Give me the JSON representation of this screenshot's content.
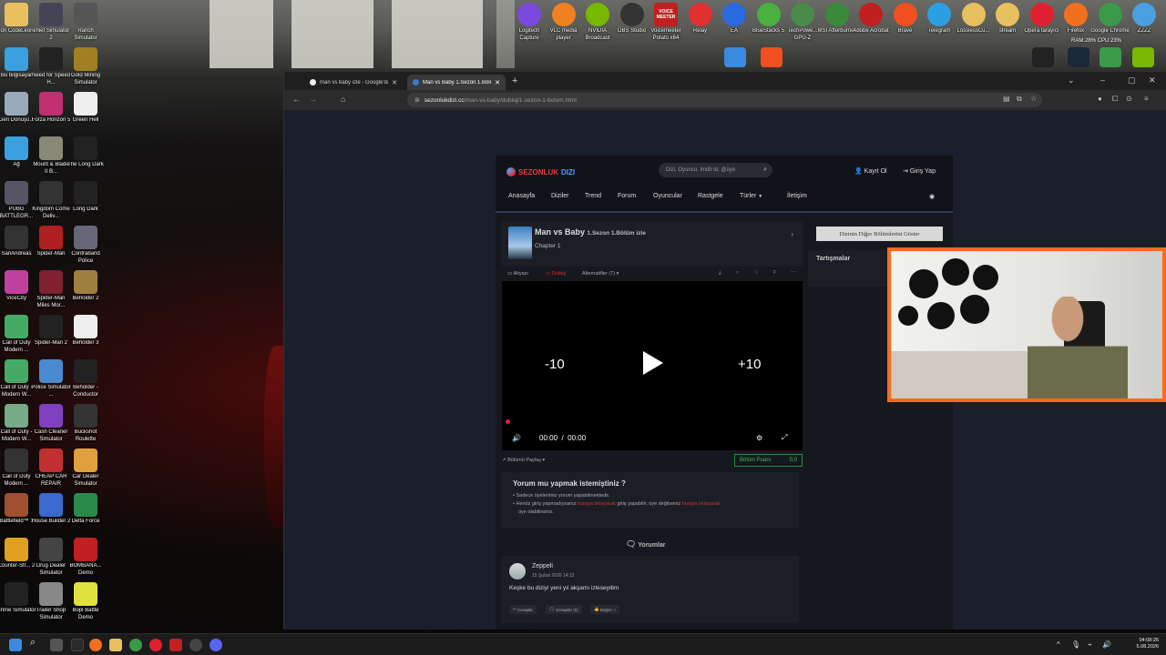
{
  "desktop": {
    "left_icons": [
      {
        "label": "Don CodeLeone",
        "icon": "folder-icon",
        "color": "#e8c060"
      },
      {
        "label": "Thief Simulator 2",
        "icon": "game-icon",
        "color": "#445"
      },
      {
        "label": "Ranch Simulator",
        "icon": "game-icon",
        "color": "#555"
      },
      {
        "label": "Bu bilgisayar",
        "icon": "computer-icon",
        "color": "#3aa0e0"
      },
      {
        "label": "Need for Speed H...",
        "icon": "game-icon",
        "color": "#222"
      },
      {
        "label": "Gold Mining Simulator",
        "icon": "game-icon",
        "color": "#a08020"
      },
      {
        "label": "Geri Dönüşü...",
        "icon": "recycle-bin-icon",
        "color": "#9ab"
      },
      {
        "label": "Forza Horizon 5",
        "icon": "game-icon",
        "color": "#c03070"
      },
      {
        "label": "Green Hell",
        "icon": "game-icon",
        "color": "#eee"
      },
      {
        "label": "Ağ",
        "icon": "network-icon",
        "color": "#3aa0e0"
      },
      {
        "label": "Mount & Blade II B...",
        "icon": "game-icon",
        "color": "#887"
      },
      {
        "label": "The Long Dark",
        "icon": "game-icon",
        "color": "#222"
      },
      {
        "label": "PUBG BATTLEGR...",
        "icon": "game-icon",
        "color": "#556"
      },
      {
        "label": "Kingdom Come Deliv...",
        "icon": "game-icon",
        "color": "#333"
      },
      {
        "label": "Long Dark",
        "icon": "game-icon",
        "color": "#222"
      },
      {
        "label": "SanAndreas",
        "icon": "game-icon",
        "color": "#333"
      },
      {
        "label": "Spider-Man",
        "icon": "game-icon",
        "color": "#b02020"
      },
      {
        "label": "Contraband Police",
        "icon": "game-icon",
        "color": "#667"
      },
      {
        "label": "ViceCity",
        "icon": "game-icon",
        "color": "#c040a0"
      },
      {
        "label": "Spider-Man Miles Mor...",
        "icon": "game-icon",
        "color": "#802030"
      },
      {
        "label": "Beholder 2",
        "icon": "game-icon",
        "color": "#a08040"
      },
      {
        "label": "Call of Duty Modern ...",
        "icon": "game-icon",
        "color": "#4a6"
      },
      {
        "label": "Spider-Man 2",
        "icon": "game-icon",
        "color": "#222"
      },
      {
        "label": "Beholder 3",
        "icon": "game-icon",
        "color": "#eee"
      },
      {
        "label": "Call of Duty - Modern W...",
        "icon": "game-icon",
        "color": "#4a6"
      },
      {
        "label": "Police Simulator ...",
        "icon": "game-icon",
        "color": "#4a8ad0"
      },
      {
        "label": "Beholder - Conductor",
        "icon": "game-icon",
        "color": "#222"
      },
      {
        "label": "Call of Duty - Modern W...",
        "icon": "game-icon",
        "color": "#7a8"
      },
      {
        "label": "Cash Cleaner Simulator",
        "icon": "game-icon",
        "color": "#8040c0"
      },
      {
        "label": "Buckshot Roulette",
        "icon": "game-icon",
        "color": "#333"
      },
      {
        "label": "Call of Duty Modern ...",
        "icon": "game-icon",
        "color": "#333"
      },
      {
        "label": "CHEAP CAR REPAIR",
        "icon": "game-icon",
        "color": "#c03030"
      },
      {
        "label": "Car Dealer Simulator",
        "icon": "game-icon",
        "color": "#e0a040"
      },
      {
        "label": "Battlefield™ 1",
        "icon": "game-icon",
        "color": "#a05030"
      },
      {
        "label": "House Builder 2",
        "icon": "game-icon",
        "color": "#3a6ad0"
      },
      {
        "label": "Delta Force",
        "icon": "game-icon",
        "color": "#2a8a4a"
      },
      {
        "label": "Counter-Str... 2",
        "icon": "game-icon",
        "color": "#e0a020"
      },
      {
        "label": "Drug Dealer Simulator",
        "icon": "game-icon",
        "color": "#444"
      },
      {
        "label": "BOMBANA... Demo",
        "icon": "game-icon",
        "color": "#c02020"
      },
      {
        "label": "Crime Simulator",
        "icon": "game-icon",
        "color": "#222"
      },
      {
        "label": "Trailer Shop Simulator",
        "icon": "game-icon",
        "color": "#888"
      },
      {
        "label": "Bopl Battle Demo",
        "icon": "game-icon",
        "color": "#e0e040"
      }
    ],
    "top_icons": [
      {
        "label": "Logitech Capture",
        "color": "#7a4ae0"
      },
      {
        "label": "VLC media player",
        "color": "#f08020"
      },
      {
        "label": "NVIDIA Broadcast",
        "color": "#76b900"
      },
      {
        "label": "OBS Studio",
        "color": "#333"
      },
      {
        "label": "Voicemeeter Potato x64",
        "color": "#c02020"
      },
      {
        "label": "Relay",
        "color": "#e03030"
      },
      {
        "label": "EA",
        "color": "#2a6ae0"
      },
      {
        "label": "BlueStacks 5",
        "color": "#4ab040"
      },
      {
        "label": "TechPowe... GPU-Z",
        "color": "#4a8a4a"
      },
      {
        "label": "MSI Afterburner",
        "color": "#3a8a3a"
      },
      {
        "label": "Adobe Acrobat",
        "color": "#c02020"
      },
      {
        "label": "Brave",
        "color": "#f05020"
      },
      {
        "label": "Telegram",
        "color": "#2aa0e0"
      },
      {
        "label": "LosslessCu...",
        "color": "#e8c060"
      },
      {
        "label": "stream",
        "color": "#e8c060"
      },
      {
        "label": "Opera tarayıcı",
        "color": "#e02030"
      },
      {
        "label": "Firefox",
        "color": "#f07020"
      },
      {
        "label": "Google Chrome",
        "color": "#3a9a4a"
      },
      {
        "label": "ZZZZ",
        "color": "#4aa0e0"
      }
    ],
    "voice_badge": "VOICE MEETER",
    "perf_overlay": "RAM:28%  CPU:23%"
  },
  "browser": {
    "tabs": [
      {
        "label": "man vs baby izle - Google'da Ar...",
        "active": false
      },
      {
        "label": "Man vs Baby 1.Sezon 1.Bölüm",
        "active": true
      }
    ],
    "new_tab": "+",
    "url_host": "sezonlukdizi.cc",
    "url_path": "/man-vs-baby/dublaj/1-sezon-1-bolum.html"
  },
  "site": {
    "logo_a": "SEZONLUK",
    "logo_b": "DIZI",
    "search_placeholder": "Dizi, Oyuncu, Imdb id, @üye",
    "register": "Kayıt Ol",
    "login": "Giriş Yap",
    "nav": [
      "Anasayfa",
      "Diziler",
      "Trend",
      "Forum",
      "Oyuncular",
      "Rastgele",
      "Türler",
      "İletişim"
    ],
    "episode": {
      "title": "Man vs Baby",
      "subtitle": "1.Sezon 1.Bölüm izle",
      "chapter": "Chapter 1"
    },
    "player_tabs": {
      "subtitle": "Altyazı",
      "dub": "Dublaj",
      "alternatives": "Alternatifler (7)"
    },
    "player": {
      "back": "-10",
      "forward": "+10",
      "time_current": "00:00",
      "time_sep": "/",
      "time_total": "00:00"
    },
    "share": "Bölümü Paylaş",
    "rating_label": "Bölüm Puanı",
    "rating_value": "0,0",
    "comment_info": {
      "title": "Yorum mu yapmak istemiştiniz ?",
      "line1": "Sadece üyelerimiz yorum yapabilmektedir.",
      "line2_a": "Henüz giriş yapmadıysanız",
      "line2_link1": "buraya tıklayarak",
      "line2_b": "giriş yapabilir, üye değilseniz",
      "line2_link2": "buraya tıklayarak",
      "line3": "üye olabilirsiniz."
    },
    "comments_header": "Yorumlar",
    "comment": {
      "author": "Zeppeli",
      "date": "15 Şubat 2026 14:12",
      "text": "Keşke bu diziyi yeni yıl akşamı izleseydim",
      "reply": "Cevapla",
      "replies": "Cevaplar (0)",
      "like": "Beğen",
      "dislike_icon": "!"
    },
    "sidebar_button": "Dizinin Diğer Bölümlerini Göster",
    "sidebar_title": "Tartışmalar"
  },
  "taskbar": {
    "time": "04:08:26",
    "date": "5.08.2026"
  }
}
